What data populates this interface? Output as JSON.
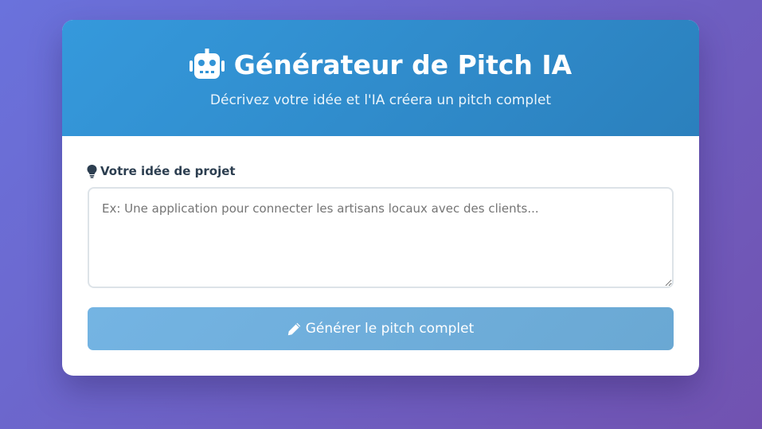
{
  "header": {
    "title": "Générateur de Pitch IA",
    "subtitle": "Décrivez votre idée et l'IA créera un pitch complet",
    "icon": "robot-icon"
  },
  "form": {
    "label": "Votre idée de projet",
    "label_icon": "lightbulb-icon",
    "idea_value": "",
    "idea_placeholder": "Ex: Une application pour connecter les artisans locaux avec des clients..."
  },
  "generate_button": {
    "label": "Générer le pitch complet",
    "icon": "pencil-icon"
  },
  "colors": {
    "background_start": "#6a72dc",
    "background_end": "#7152b0",
    "header_start": "#3599dc",
    "header_end": "#2b80bd",
    "button": "#6fb0de",
    "label_text": "#2c3e50"
  }
}
